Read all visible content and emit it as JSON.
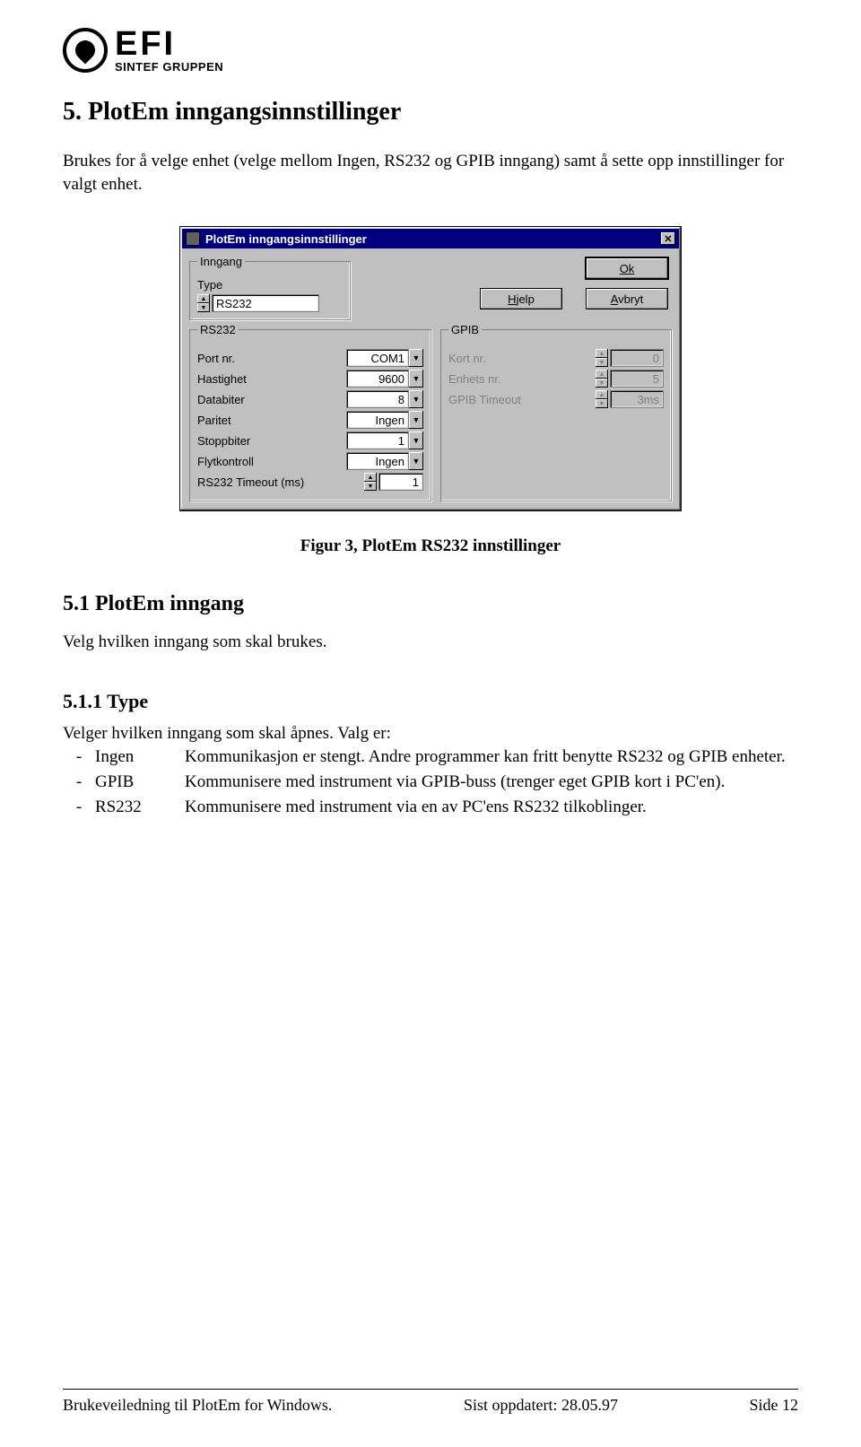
{
  "logo": {
    "efi": "EFI",
    "sintef": "SINTEF GRUPPEN"
  },
  "h1": "5.  PlotEm inngangsinnstillinger",
  "intro": "Brukes for å velge enhet (velge mellom Ingen, RS232 og GPIB inngang) samt å sette opp innstillinger for valgt enhet.",
  "dlg": {
    "title": "PlotEm inngangsinnstillinger",
    "close": "✕",
    "ok": "Ok",
    "help_u": "H",
    "help_rest": "jelp",
    "cancel_u": "A",
    "cancel_rest": "vbryt",
    "inngang_legend": "Inngang",
    "type_label": "Type",
    "type_value": "RS232",
    "rs232_legend": "RS232",
    "rs232": {
      "port_l": "Port nr.",
      "port_v": "COM1",
      "hast_l": "Hastighet",
      "hast_v": "9600",
      "datab_l": "Databiter",
      "datab_v": "8",
      "paritet_l": "Paritet",
      "paritet_v": "Ingen",
      "stop_l": "Stoppbiter",
      "stop_v": "1",
      "flyt_l": "Flytkontroll",
      "flyt_v": "Ingen",
      "timeout_l": "RS232 Timeout (ms)",
      "timeout_v": "1"
    },
    "gpib_legend": "GPIB",
    "gpib": {
      "kort_l": "Kort nr.",
      "kort_v": "0",
      "enhet_l": "Enhets nr.",
      "enhet_v": "5",
      "timeout_l": "GPIB Timeout",
      "timeout_v": "3ms"
    }
  },
  "caption": "Figur 3, PlotEm RS232 innstillinger",
  "h2": "5.1  PlotEm inngang",
  "p2": "Velg hvilken inngang som skal brukes.",
  "h3": "5.1.1  Type",
  "list_intro": "Velger hvilken inngang som skal åpnes. Valg er:",
  "li1_k": "Ingen",
  "li1_d": "Kommunikasjon er stengt. Andre programmer kan fritt benytte RS232 og GPIB enheter.",
  "li2_k": "GPIB",
  "li2_d": "Kommunisere med instrument via GPIB-buss (trenger eget GPIB kort i PC'en).",
  "li3_k": "RS232",
  "li3_d": "Kommunisere med instrument via en av PC'ens RS232 tilkoblinger.",
  "footer": {
    "left": "Brukeveiledning til PlotEm for Windows.",
    "mid": "Sist oppdatert: 28.05.97",
    "right": "Side 12"
  }
}
